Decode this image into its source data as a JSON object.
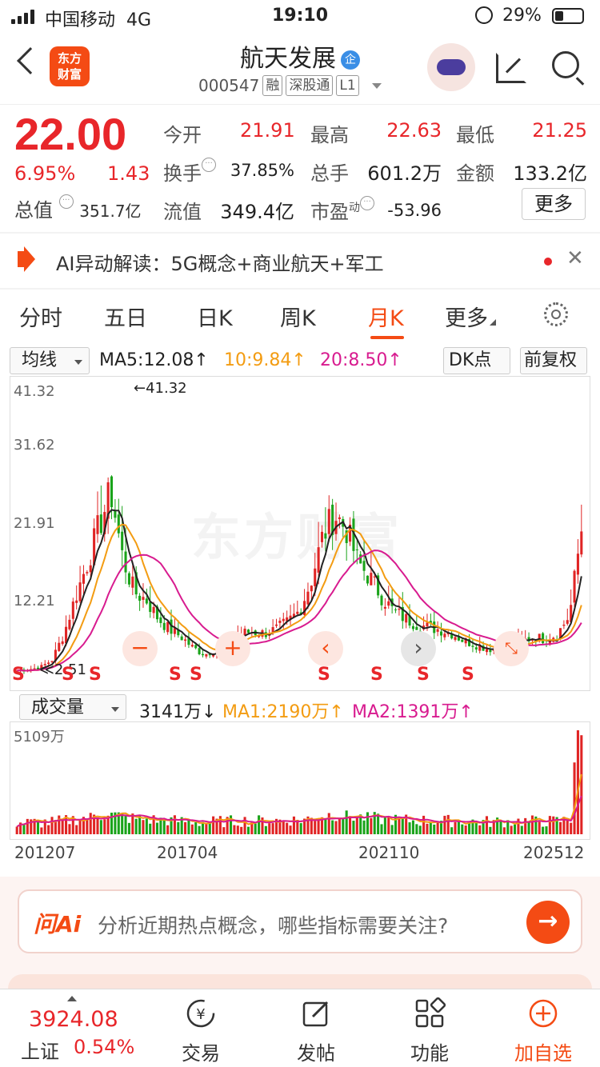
{
  "status": {
    "carrier": "中国移动",
    "network": "4G",
    "time": "19:10",
    "battery": "29%"
  },
  "nav": {
    "logo_top": "东方",
    "logo_bottom": "财富",
    "title": "航天发展",
    "badge": "企",
    "code": "000547",
    "tags": [
      "融",
      "深股通",
      "L1"
    ]
  },
  "quote": {
    "price": "22.00",
    "pct": "6.95%",
    "chg": "1.43",
    "cap_label": "总值",
    "cap_value": "351.7亿",
    "open_label": "今开",
    "open": "21.91",
    "high_label": "最高",
    "high": "22.63",
    "low_label": "最低",
    "low": "21.25",
    "turn_label": "换手",
    "turn": "37.85%",
    "vol_label": "总手",
    "vol": "601.2万",
    "amt_label": "金额",
    "amt": "133.2亿",
    "float_label": "流值",
    "float": "349.4亿",
    "pe_label": "市盈",
    "pe_sup": "动",
    "pe": "-53.96",
    "more": "更多"
  },
  "alert": {
    "text": "AI异动解读：5G概念+商业航天+军工",
    "close": "✕"
  },
  "tabs": [
    "分时",
    "五日",
    "日K",
    "周K",
    "月K",
    "更多"
  ],
  "ma": {
    "select": "均线",
    "ma5": "MA5:12.08↑",
    "ma10": "10:9.84↑",
    "ma20": "20:8.50↑",
    "dk": "DK点",
    "fq": "前复权",
    "ma5_color": "#222222",
    "ma10_color": "#f39c12",
    "ma20_color": "#d81b8f"
  },
  "chart_data": {
    "type": "candlestick",
    "y_ticks": [
      "41.32",
      "31.62",
      "21.91",
      "12.21"
    ],
    "ylim": [
      2.51,
      41.32
    ],
    "max_label": "←41.32",
    "min_label": "≪2.51",
    "signal": "S",
    "close_trend": [
      3.0,
      3.2,
      3.4,
      4.5,
      8.0,
      13.0,
      17.5,
      22.5,
      27.0,
      18.0,
      13.5,
      12.5,
      10.0,
      8.5,
      7.5,
      6.0,
      5.2,
      6.0,
      6.8,
      8.0,
      8.2,
      8.0,
      8.5,
      9.5,
      11.0,
      15.0,
      21.0,
      24.0,
      22.0,
      17.5,
      15.5,
      13.0,
      11.0,
      10.0,
      9.2,
      8.8,
      8.5,
      8.0,
      7.0,
      6.5,
      6.0,
      5.8,
      6.5,
      7.0,
      7.5,
      7.2,
      8.0,
      10.5,
      22.0
    ]
  },
  "volume": {
    "select": "成交量",
    "vol": "3141万↓",
    "ma1": "MA1:2190万↑",
    "ma2": "MA2:1391万↑",
    "y_max": "5109万",
    "x_labels": [
      "201207",
      "201704",
      "202110",
      "202512"
    ]
  },
  "ask": {
    "brand": "问Ai",
    "placeholder": "分析近期热点概念，哪些指标需要关注?",
    "go": "→"
  },
  "bottom": {
    "index_value": "3924.08",
    "index_name": "上证",
    "index_pct": "0.54%",
    "items": [
      {
        "label": "交易",
        "icon": "yen-cycle-icon"
      },
      {
        "label": "发帖",
        "icon": "edit-icon"
      },
      {
        "label": "功能",
        "icon": "grid-icon"
      },
      {
        "label": "加自选",
        "icon": "plus-circle-icon"
      }
    ]
  }
}
